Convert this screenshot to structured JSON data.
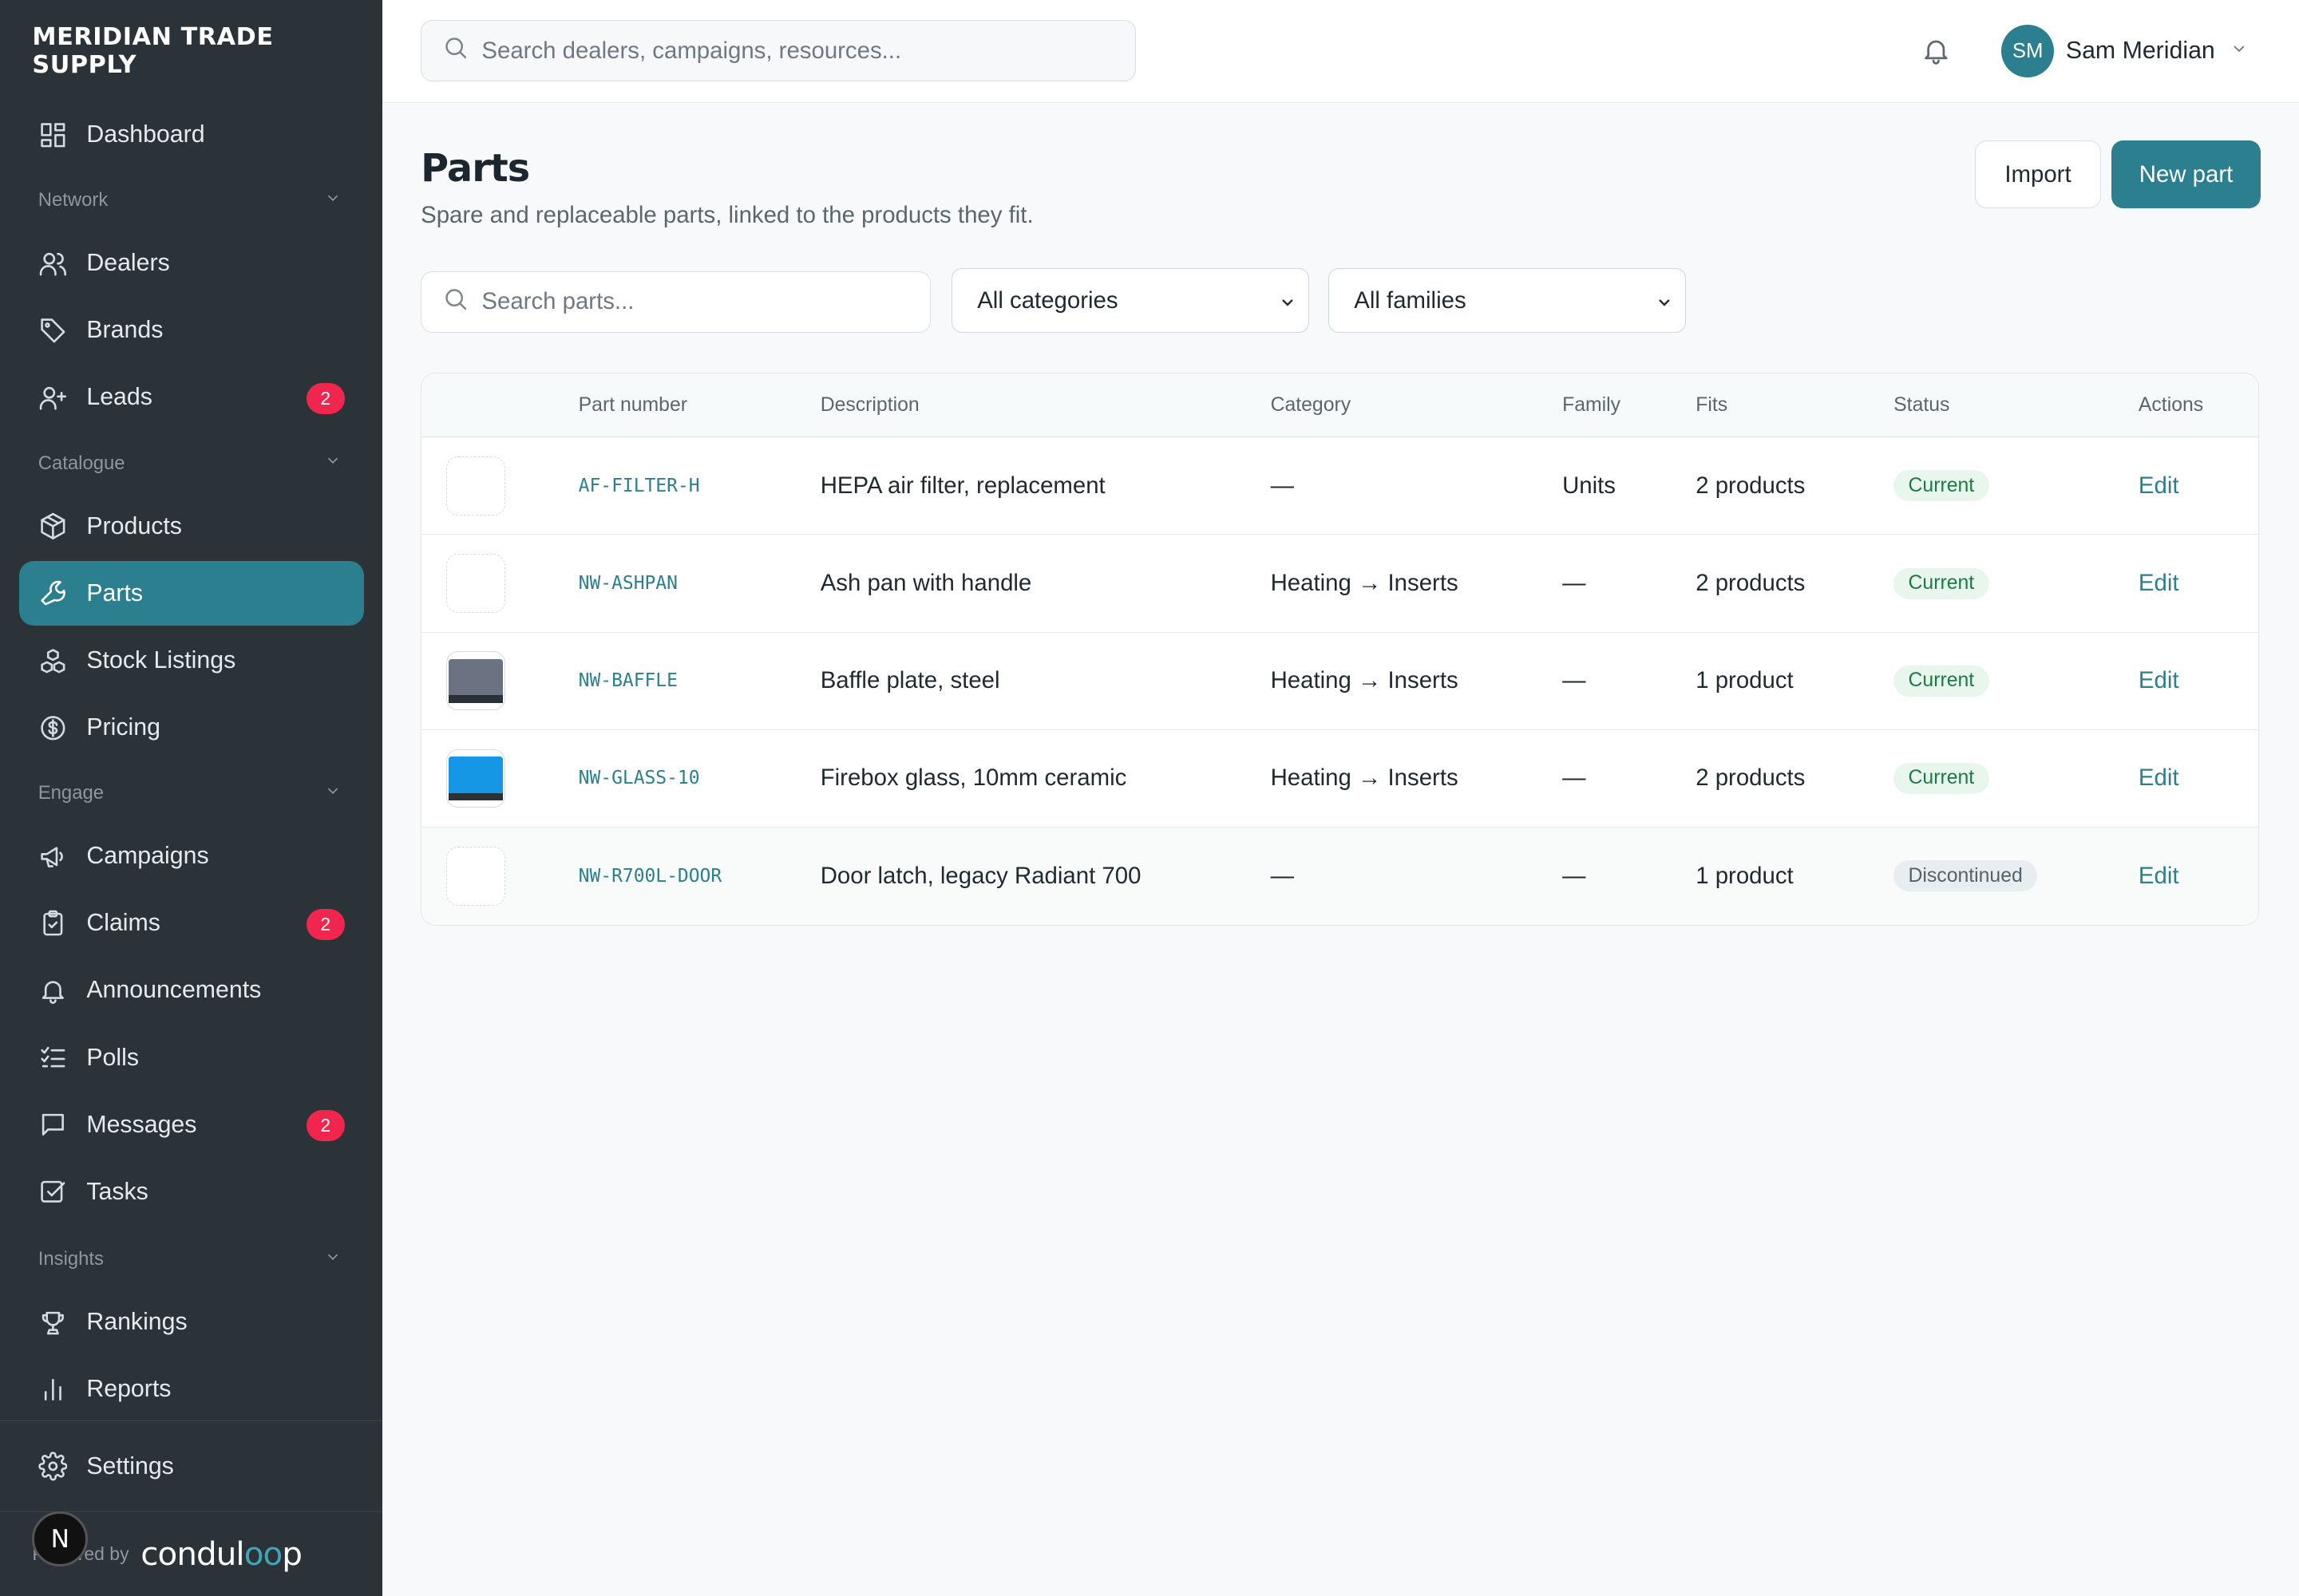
{
  "sidebar": {
    "brand": "MERIDIAN TRADE SUPPLY",
    "dashboard": "Dashboard",
    "sections": {
      "network": "Network",
      "catalogue": "Catalogue",
      "engage": "Engage",
      "insights": "Insights"
    },
    "items": {
      "dealers": "Dealers",
      "brands": "Brands",
      "leads": "Leads",
      "leads_badge": "2",
      "products": "Products",
      "parts": "Parts",
      "stock": "Stock Listings",
      "pricing": "Pricing",
      "campaigns": "Campaigns",
      "claims": "Claims",
      "claims_badge": "2",
      "announcements": "Announcements",
      "polls": "Polls",
      "messages": "Messages",
      "messages_badge": "2",
      "tasks": "Tasks",
      "rankings": "Rankings",
      "reports": "Reports",
      "settings": "Settings"
    },
    "powered_by": "Powered by",
    "powered_logo_a": "condul",
    "powered_logo_b": "oo",
    "powered_logo_c": "p",
    "n_badge": "N",
    "active_color": "#2b7f8e"
  },
  "topbar": {
    "search_placeholder": "Search dealers, campaigns, resources...",
    "avatar_initials": "SM",
    "user_name": "Sam Meridian"
  },
  "page": {
    "title": "Parts",
    "subtitle": "Spare and replaceable parts, linked to the products they fit.",
    "import_label": "Import",
    "new_label": "New part",
    "search_placeholder": "Search parts...",
    "category_filter": "All categories",
    "family_filter": "All families"
  },
  "table": {
    "headers": {
      "part_number": "Part number",
      "description": "Description",
      "category": "Category",
      "family": "Family",
      "fits": "Fits",
      "status": "Status",
      "actions": "Actions"
    },
    "rows": [
      {
        "part": "AF-FILTER-H",
        "description": "HEPA air filter, replacement",
        "category": "—",
        "family": "Units",
        "fits": "2 products",
        "status": "Current",
        "action": "Edit"
      },
      {
        "part": "NW-ASHPAN",
        "description": "Ash pan with handle",
        "category": "Heating → Inserts",
        "family": "—",
        "fits": "2 products",
        "status": "Current",
        "action": "Edit"
      },
      {
        "part": "NW-BAFFLE",
        "description": "Baffle plate, steel",
        "category": "Heating → Inserts",
        "family": "—",
        "fits": "1 product",
        "status": "Current",
        "action": "Edit"
      },
      {
        "part": "NW-GLASS-10",
        "description": "Firebox glass, 10mm ceramic",
        "category": "Heating → Inserts",
        "family": "—",
        "fits": "2 products",
        "status": "Current",
        "action": "Edit"
      },
      {
        "part": "NW-R700L-DOOR",
        "description": "Door latch, legacy Radiant 700",
        "category": "—",
        "family": "—",
        "fits": "1 product",
        "status": "Discontinued",
        "action": "Edit"
      }
    ]
  }
}
